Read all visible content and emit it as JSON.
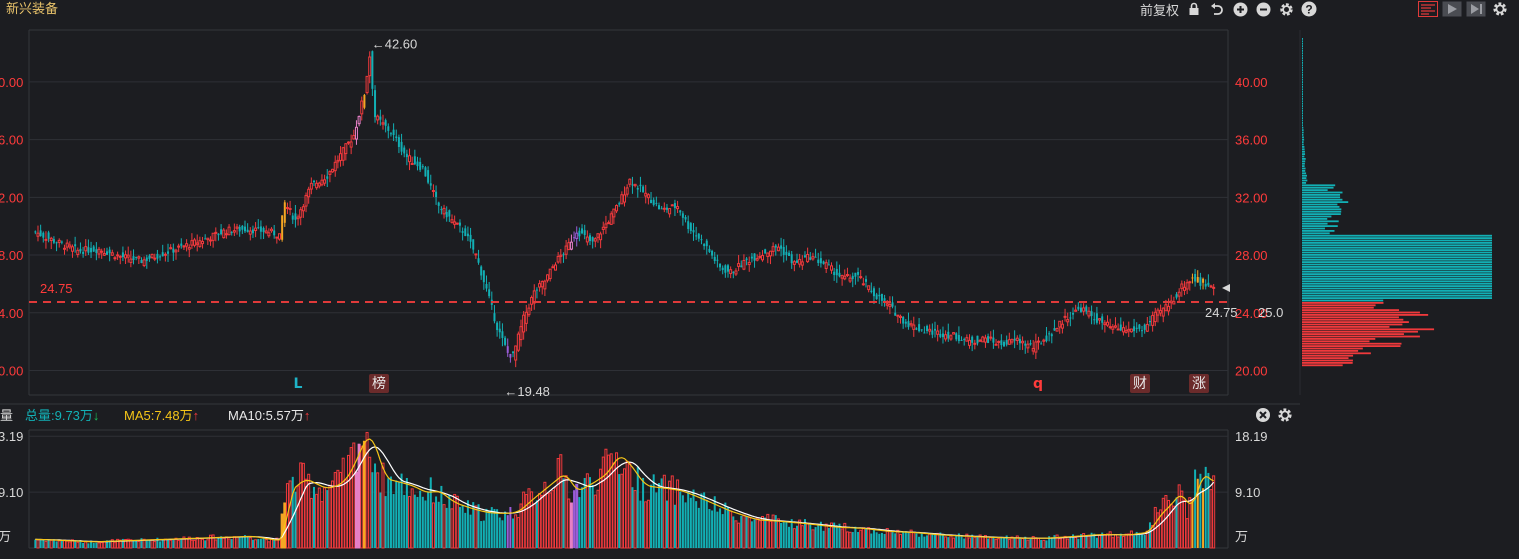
{
  "header": {
    "title": "新兴装备",
    "fuquan_label": "前复权",
    "tool_icons": [
      "lock-icon",
      "undo-icon",
      "zoom-in-icon",
      "zoom-out-icon",
      "gear-icon",
      "help-icon"
    ],
    "view_icons": [
      "kline-view-icon",
      "play-icon",
      "forward-icon",
      "gear-icon"
    ]
  },
  "price_chart": {
    "price_labels": [
      "40.00",
      "36.00",
      "32.00",
      "28.00",
      "24.00",
      "20.00"
    ],
    "left_labels": [
      "0.00",
      "6.00",
      "2.00",
      "8.00",
      "4.00",
      "0.00"
    ],
    "high_label": "←42.60",
    "low_label": "←19.48",
    "current_line_value": 24.75,
    "current_label_left": "24.75",
    "current_label_right": "24.75",
    "current_label_right2": "25.0",
    "ylim": [
      18.3,
      43.6
    ],
    "markers": [
      {
        "text": "L",
        "color": "#1fb3c7",
        "boxed": false
      },
      {
        "text": "榜",
        "color": "#e8e8e8",
        "boxed": true
      },
      {
        "text": "q",
        "color": "#ff3b3b",
        "boxed": false
      },
      {
        "text": "财",
        "color": "#e8e8e8",
        "boxed": true
      },
      {
        "text": "涨",
        "color": "#e8e8e8",
        "boxed": true
      }
    ]
  },
  "volume_chart": {
    "label": "量",
    "total": "总量:9.73万",
    "ma5": "MA5:7.48万",
    "ma10": "MA10:5.57万",
    "right_labels": [
      "18.19",
      "9.10",
      "万"
    ],
    "left_labels": [
      "3.19",
      "9.10",
      "万"
    ],
    "ylim": [
      0,
      19.2
    ]
  },
  "colors": {
    "up": "#f0393c",
    "down": "#12b0b5",
    "ma5": "#f5c518",
    "ma10": "#ffffff",
    "grid": "#2e3036",
    "dash": "#e03a3a",
    "highlight_yellow": "#f5a623",
    "highlight_purple": "#9a5cd8",
    "highlight_pink": "#e77fc7"
  },
  "chart_data": {
    "type": "candlestick",
    "series_anchors": [
      [
        0,
        29.6
      ],
      [
        8,
        28.9
      ],
      [
        16,
        28.3
      ],
      [
        24,
        28.4
      ],
      [
        32,
        27.9
      ],
      [
        40,
        27.6
      ],
      [
        48,
        28.1
      ],
      [
        56,
        28.6
      ],
      [
        64,
        29.1
      ],
      [
        72,
        29.7
      ],
      [
        80,
        29.8
      ],
      [
        88,
        29.6
      ],
      [
        92,
        29.4
      ],
      [
        94,
        31.6
      ],
      [
        98,
        30.4
      ],
      [
        104,
        32.8
      ],
      [
        110,
        33.5
      ],
      [
        116,
        35.2
      ],
      [
        120,
        36.3
      ],
      [
        124,
        39.2
      ],
      [
        126,
        41.8
      ],
      [
        128,
        37.6
      ],
      [
        134,
        36.5
      ],
      [
        140,
        34.8
      ],
      [
        146,
        34.0
      ],
      [
        152,
        31.4
      ],
      [
        158,
        30.2
      ],
      [
        162,
        29.5
      ],
      [
        166,
        28.0
      ],
      [
        170,
        25.6
      ],
      [
        174,
        23.0
      ],
      [
        178,
        21.2
      ],
      [
        180,
        21.0
      ],
      [
        184,
        23.6
      ],
      [
        188,
        25.4
      ],
      [
        192,
        26.2
      ],
      [
        196,
        27.5
      ],
      [
        200,
        28.4
      ],
      [
        204,
        29.7
      ],
      [
        210,
        28.8
      ],
      [
        216,
        30.4
      ],
      [
        220,
        31.6
      ],
      [
        224,
        33.2
      ],
      [
        230,
        32.2
      ],
      [
        236,
        31.1
      ],
      [
        242,
        31.4
      ],
      [
        246,
        30.0
      ],
      [
        252,
        28.8
      ],
      [
        258,
        27.1
      ],
      [
        262,
        26.8
      ],
      [
        268,
        27.6
      ],
      [
        274,
        28.1
      ],
      [
        280,
        28.6
      ],
      [
        286,
        27.4
      ],
      [
        292,
        27.9
      ],
      [
        298,
        27.3
      ],
      [
        304,
        26.4
      ],
      [
        310,
        26.5
      ],
      [
        316,
        25.3
      ],
      [
        322,
        24.4
      ],
      [
        328,
        23.3
      ],
      [
        334,
        22.8
      ],
      [
        340,
        22.6
      ],
      [
        346,
        22.4
      ],
      [
        352,
        22.0
      ],
      [
        358,
        22.2
      ],
      [
        364,
        21.8
      ],
      [
        370,
        22.1
      ],
      [
        376,
        21.6
      ],
      [
        382,
        22.4
      ],
      [
        388,
        23.6
      ],
      [
        394,
        24.3
      ],
      [
        400,
        23.5
      ],
      [
        406,
        22.9
      ],
      [
        412,
        22.8
      ],
      [
        418,
        22.9
      ],
      [
        422,
        23.8
      ],
      [
        428,
        24.7
      ],
      [
        432,
        25.8
      ],
      [
        436,
        26.4
      ],
      [
        440,
        25.9
      ],
      [
        444,
        26.0
      ]
    ],
    "volume_anchors": [
      [
        0,
        1.4
      ],
      [
        20,
        1.0
      ],
      [
        40,
        1.3
      ],
      [
        60,
        1.6
      ],
      [
        80,
        1.9
      ],
      [
        90,
        1.2
      ],
      [
        92,
        1.5
      ],
      [
        94,
        9.2
      ],
      [
        100,
        11.3
      ],
      [
        108,
        9.6
      ],
      [
        114,
        10.5
      ],
      [
        118,
        13.1
      ],
      [
        122,
        17.5
      ],
      [
        124,
        18.3
      ],
      [
        126,
        17.2
      ],
      [
        130,
        11.3
      ],
      [
        140,
        10.2
      ],
      [
        146,
        8.9
      ],
      [
        150,
        9.4
      ],
      [
        156,
        7.4
      ],
      [
        162,
        6.5
      ],
      [
        168,
        5.8
      ],
      [
        174,
        5.6
      ],
      [
        180,
        5.8
      ],
      [
        186,
        8.1
      ],
      [
        192,
        10.2
      ],
      [
        196,
        11.6
      ],
      [
        198,
        12.3
      ],
      [
        202,
        9.1
      ],
      [
        208,
        10.5
      ],
      [
        214,
        12.2
      ],
      [
        218,
        15.3
      ],
      [
        222,
        13.8
      ],
      [
        228,
        10.1
      ],
      [
        236,
        9.7
      ],
      [
        242,
        9.3
      ],
      [
        250,
        7.9
      ],
      [
        260,
        6.0
      ],
      [
        270,
        4.6
      ],
      [
        280,
        4.3
      ],
      [
        290,
        3.9
      ],
      [
        300,
        3.4
      ],
      [
        310,
        3.2
      ],
      [
        320,
        2.7
      ],
      [
        330,
        2.5
      ],
      [
        340,
        2.1
      ],
      [
        350,
        1.9
      ],
      [
        360,
        1.7
      ],
      [
        370,
        1.6
      ],
      [
        380,
        1.6
      ],
      [
        390,
        1.9
      ],
      [
        400,
        2.2
      ],
      [
        410,
        2.1
      ],
      [
        418,
        2.6
      ],
      [
        422,
        5.4
      ],
      [
        426,
        7.0
      ],
      [
        430,
        9.2
      ],
      [
        434,
        5.9
      ],
      [
        438,
        12.6
      ],
      [
        442,
        10.4
      ],
      [
        444,
        11.1
      ]
    ],
    "high": 42.6,
    "low": 19.48,
    "last_close": 24.75,
    "volume_max": 18.19,
    "volume_mid": 9.1
  }
}
